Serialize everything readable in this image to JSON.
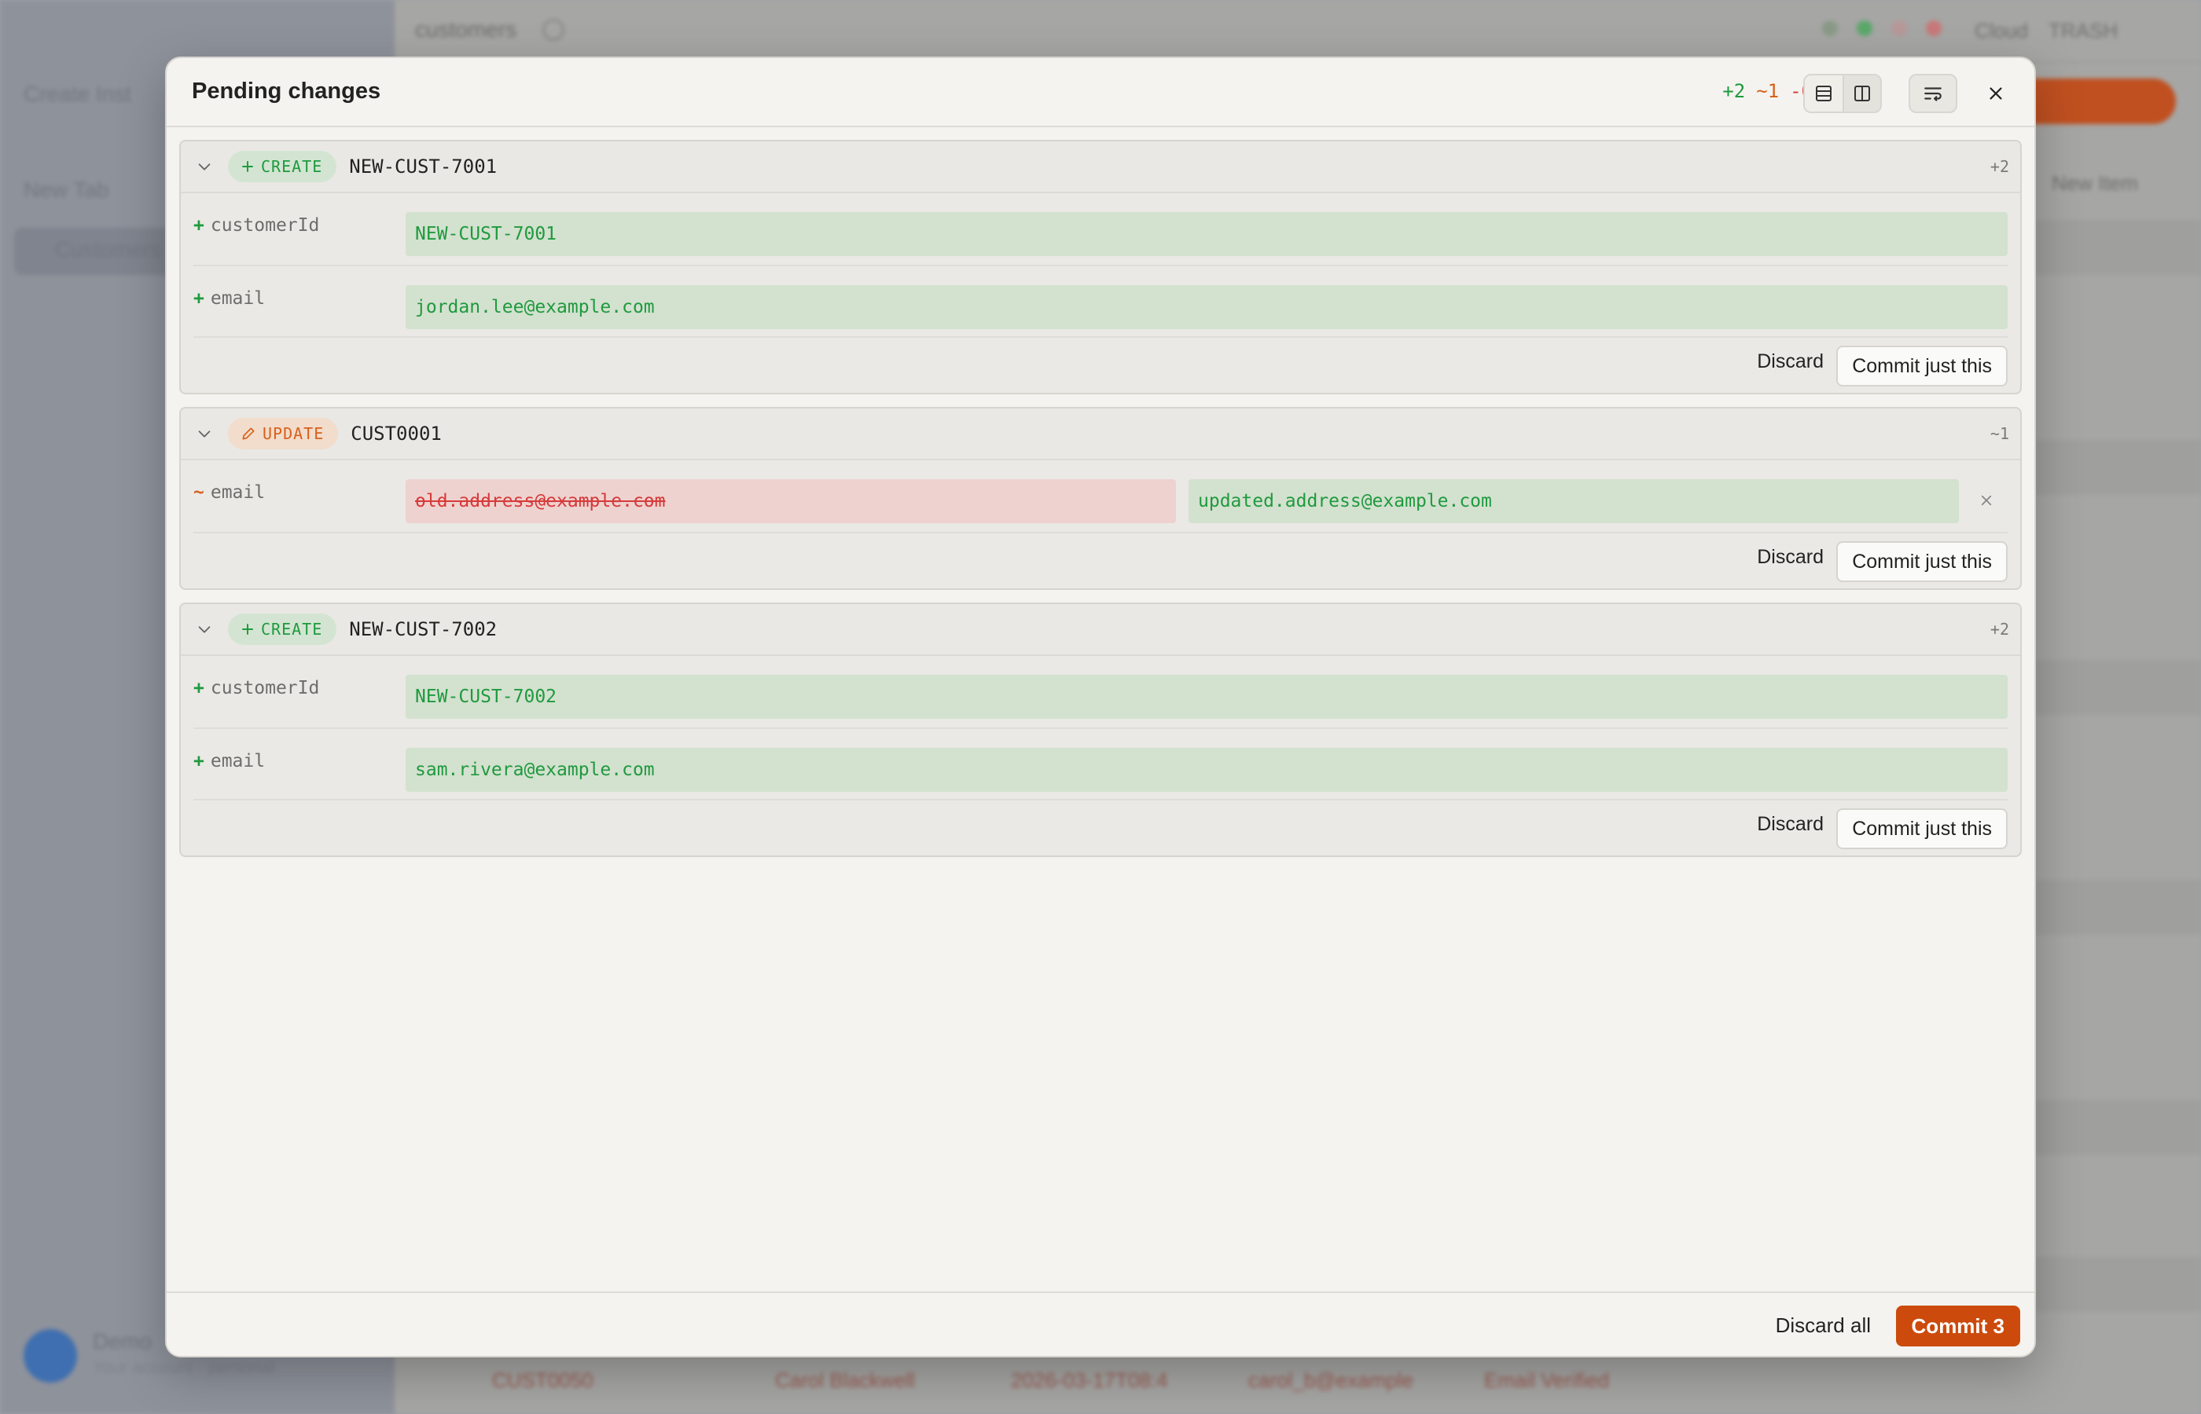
{
  "modal": {
    "title": "Pending changes",
    "summary": {
      "added": "+2",
      "modified": "~1",
      "deleted": "-0"
    },
    "cards": [
      {
        "action": "CREATE",
        "record_id": "NEW-CUST-7001",
        "count": "+2",
        "fields": [
          {
            "marker": "+",
            "name": "customerId",
            "new_value": "NEW-CUST-7001"
          },
          {
            "marker": "+",
            "name": "email",
            "new_value": "jordan.lee@example.com"
          }
        ],
        "discard_label": "Discard",
        "commit_label": "Commit just this"
      },
      {
        "action": "UPDATE",
        "record_id": "CUST0001",
        "count": "~1",
        "fields": [
          {
            "marker": "~",
            "name": "email",
            "old_value": "old.address@example.com",
            "new_value": "updated.address@example.com"
          }
        ],
        "discard_label": "Discard",
        "commit_label": "Commit just this"
      },
      {
        "action": "CREATE",
        "record_id": "NEW-CUST-7002",
        "count": "+2",
        "fields": [
          {
            "marker": "+",
            "name": "customerId",
            "new_value": "NEW-CUST-7002"
          },
          {
            "marker": "+",
            "name": "email",
            "new_value": "sam.rivera@example.com"
          }
        ],
        "discard_label": "Discard",
        "commit_label": "Commit just this"
      }
    ],
    "footer": {
      "discard_all_label": "Discard all",
      "commit_label": "Commit 3"
    }
  },
  "background": {
    "table_title": "customers",
    "status_label": "Cloud",
    "status_label_2": "TRASH",
    "sidebar_items": [
      "Create Inst",
      "New Tab",
      "Customers"
    ],
    "new_item_label": "New Item",
    "user_name": "Demo",
    "user_sub": "Your account · personal",
    "bottom_row": [
      "CUST0050",
      "Carol Blackwell",
      "2026-03-17T08:4",
      "carol_b@example",
      "Email Verified"
    ]
  },
  "colors": {
    "accent": "#cc4a0c",
    "added": "#1f9a3e",
    "modified": "#d8601a",
    "deleted": "#d63a3a"
  }
}
